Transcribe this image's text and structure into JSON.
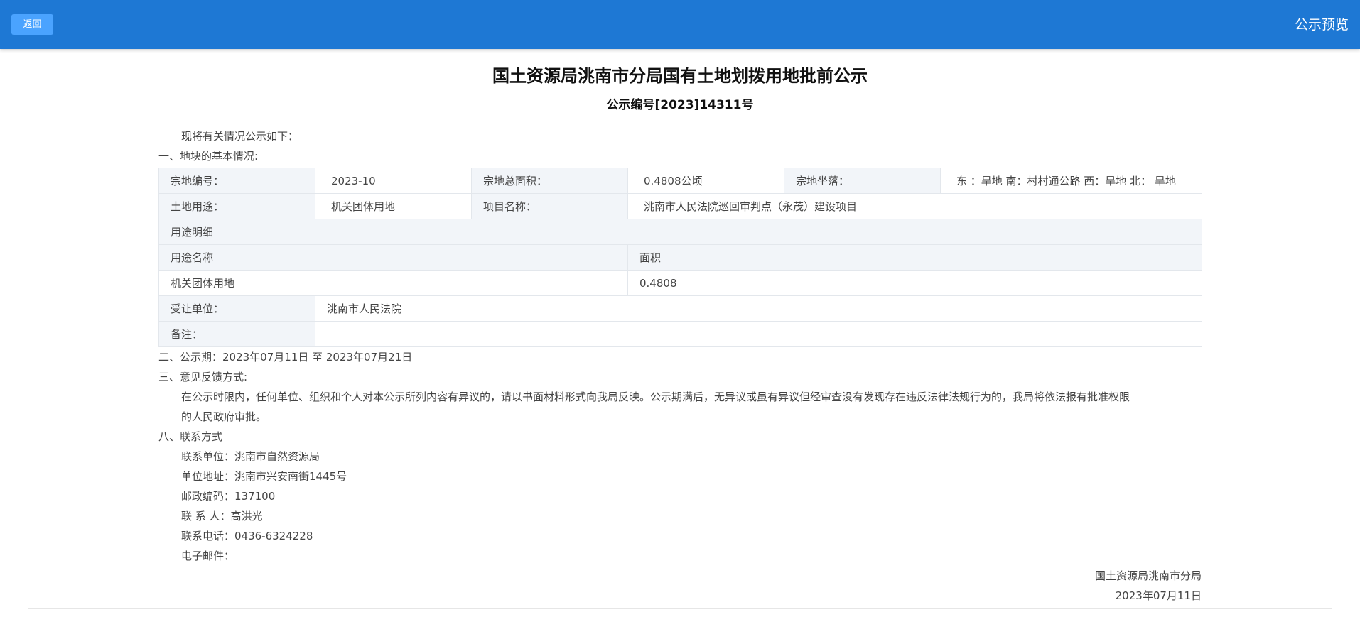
{
  "header": {
    "back_label": "返回",
    "title": "公示预览"
  },
  "document": {
    "title": "国土资源局洮南市分局国有土地划拨用地批前公示",
    "subtitle": "公示编号[2023]14311号",
    "intro": "现将有关情况公示如下：",
    "section1_heading": "一、地块的基本情况:",
    "table": {
      "parcel_no_label": "宗地编号：",
      "parcel_no_value": "2023-10",
      "total_area_label": "宗地总面积：",
      "total_area_value": "0.4808公顷",
      "location_label": "宗地坐落：",
      "location_value": "东 ：旱地 南：村村通公路 西：旱地 北： 旱地",
      "land_use_label": "土地用途：",
      "land_use_value": "机关团体用地",
      "project_name_label": "项目名称：",
      "project_name_value": "洮南市人民法院巡回审判点（永茂）建设项目",
      "use_detail_label": "用途明细",
      "use_name_header": "用途名称",
      "area_header": "面积",
      "use_name_value": "机关团体用地",
      "area_value": "0.4808",
      "recipient_label": "受让单位：",
      "recipient_value": "洮南市人民法院",
      "remark_label": "备注：",
      "remark_value": ""
    },
    "section2": "二、公示期：2023年07月11日 至 2023年07月21日",
    "section3_heading": "三、意见反馈方式:",
    "section3_body_line1": "在公示时限内，任何单位、组织和个人对本公示所列内容有异议的，请以书面材料形式向我局反映。公示期满后，无异议或虽有异议但经审查没有发现存在违反法律法规行为的，我局将依法报有批准权限",
    "section3_body_line2": "的人民政府审批。",
    "section8_heading": "八、联系方式",
    "contact_unit": "联系单位：洮南市自然资源局",
    "contact_address": "单位地址：洮南市兴安南街1445号",
    "contact_postcode": "邮政编码：137100",
    "contact_person": "联 系 人：高洪光",
    "contact_phone": "联系电话：0436-6324228",
    "contact_email": "电子邮件：",
    "sign_org": "国土资源局洮南市分局",
    "sign_date": "2023年07月11日"
  }
}
